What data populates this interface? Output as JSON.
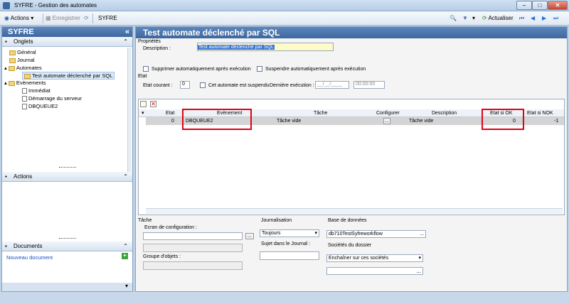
{
  "window": {
    "title": "SYFRE -  Gestion des automates",
    "min": "–",
    "max": "□",
    "close": "✕"
  },
  "toolbar": {
    "actions": "Actions",
    "save": "Enregistrer",
    "breadcrumb": "SYFRE",
    "refresh": "Actualiser"
  },
  "left": {
    "app_title": "SYFRE",
    "collapse": "«",
    "onglets": "Onglets",
    "actions": "Actions",
    "documents": "Documents",
    "new_doc": "Nouveau document",
    "add": "+",
    "tree": [
      "Général",
      "Journal",
      "Automates",
      "Test automate déclenché par SQL",
      "Evènements",
      "Immédiat",
      "Démarrage du serveur",
      "DBQUEUE2"
    ]
  },
  "main": {
    "title": "Test automate déclenché par SQL",
    "props": "Propriétés",
    "desc_label": "Description :",
    "desc_value": "Test automate déclenché par SQL",
    "chk_delete": "Supprimer automatiquement après exécution",
    "chk_suspend": "Suspendre automatiquement après exécution",
    "etat": "Etat",
    "etat_courant": "Etat courant :",
    "etat_value": "0",
    "suspended": "Cet automate est suspendu",
    "last_exec": "Dernière exécution :",
    "date_ph": "__/__/____",
    "time_value": "00:00:00"
  },
  "grid": {
    "columns": [
      "Etat",
      "Evènement",
      "Tâche",
      "Configurer",
      "Description",
      "Etat si OK",
      "Etat si NOK"
    ],
    "rows": [
      {
        "etat": "0",
        "event": "DBQUEUE2",
        "task": "Tâche vide",
        "config": "...",
        "desc": "Tâche vide",
        "ok": "0",
        "nok": "-1"
      }
    ]
  },
  "tache": {
    "title": "Tâche",
    "ecran": "Ecran de configuration :",
    "groupe": "Groupe d'objets :",
    "browse": "..."
  },
  "journal": {
    "title": "Journalisation",
    "value": "Toujours",
    "sujet": "Sujet dans le Journal :"
  },
  "db": {
    "title": "Base de données",
    "value": "db710TestSyfreworkflow",
    "browse": "...",
    "societes": "Sociétés du dossier",
    "soc_value": "Enchaîner sur ces sociétés"
  }
}
